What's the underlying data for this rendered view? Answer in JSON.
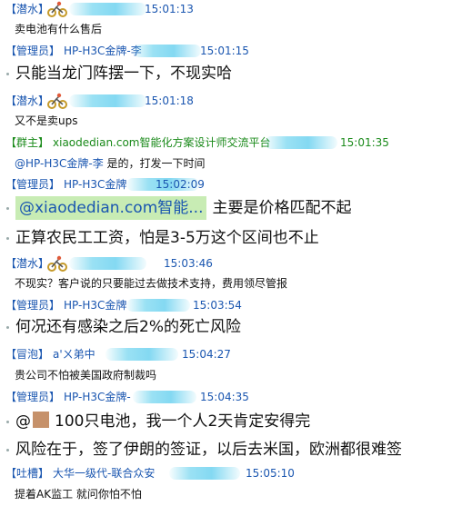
{
  "messages": [
    {
      "role": "【潜水】",
      "nick": "",
      "time": "15:01:13",
      "text": "卖电池有什么售后",
      "size": "small"
    },
    {
      "role": "【管理员】",
      "nick": "HP-H3C金牌-李",
      "time": "15:01:15",
      "text": "只能当龙门阵摆一下，不现实哈",
      "size": "big"
    },
    {
      "role": "【潜水】",
      "nick": "",
      "time": "15:01:18",
      "text": "又不是卖ups",
      "size": "small"
    },
    {
      "role": "【群主】",
      "nick": "xiaodedian.com智能化方案设计师交流平台",
      "time": "15:01:35",
      "mention": "@HP-H3C金牌-李",
      "text": " 是的，打发一下时间",
      "size": "small"
    },
    {
      "role": "【管理员】",
      "nick": "HP-H3C金牌",
      "time": "15:02:09",
      "quote": "@xiaodedian.com智能...",
      "text": "主要是价格匹配不起",
      "text2": "正算农民工工资，怕是3-5万这个区间也不止",
      "size": "big"
    },
    {
      "role": "【潜水】",
      "nick": "",
      "time": "15:03:46",
      "text": "不现实？客户说的只要能过去做技术支持，费用领尽管报",
      "size": "small"
    },
    {
      "role": "【管理员】",
      "nick": "HP-H3C金牌",
      "time": "15:03:54",
      "text": "何况还有感染之后2%的死亡风险",
      "size": "big"
    },
    {
      "role": "【冒泡】",
      "nick": "a'ㄨ弟中",
      "time": "15:04:27",
      "text": "贵公司不怕被美国政府制裁吗",
      "size": "small"
    },
    {
      "role": "【管理员】",
      "nick": "HP-H3C金牌-",
      "time": "15:04:35",
      "mention": "@",
      "text": "100只电池，我一个人2天肯定安得完",
      "text2": "风险在于，签了伊朗的签证，以后去米国，欧洲都很难签",
      "size": "big"
    },
    {
      "role": "【吐槽】",
      "nick": "大华一级代-联合众安",
      "time": "15:05:10",
      "text": "提着AK监工  就问你怕不怕",
      "size": "small"
    }
  ],
  "colors": {
    "name": "#1a56b0",
    "owner": "#1a8a1a",
    "quote_bg": "#c8ecb4"
  }
}
